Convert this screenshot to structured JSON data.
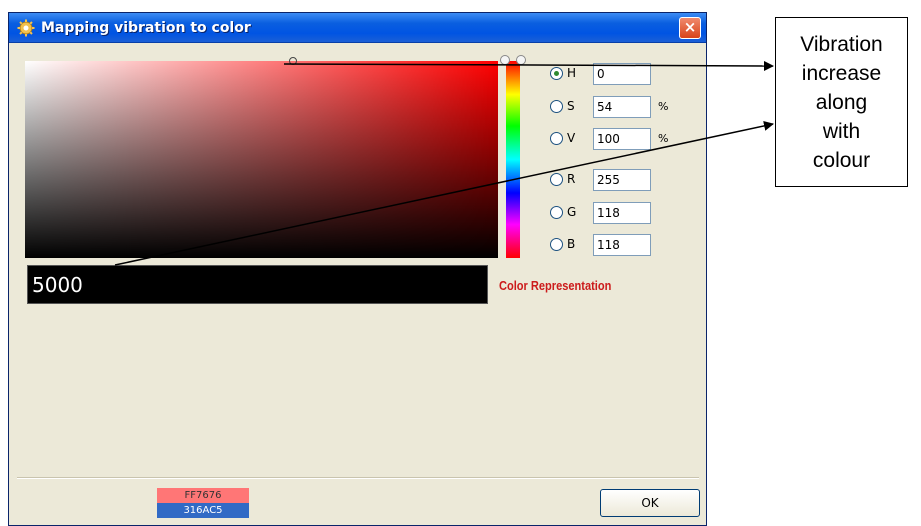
{
  "window": {
    "title": "Mapping vibration to color",
    "close_label": "×"
  },
  "picker": {
    "fields": [
      {
        "letter": "H",
        "value": "0",
        "unit": "",
        "checked": true
      },
      {
        "letter": "S",
        "value": "54",
        "unit": "%",
        "checked": false
      },
      {
        "letter": "V",
        "value": "100",
        "unit": "%",
        "checked": false
      },
      {
        "letter": "R",
        "value": "255",
        "unit": "",
        "checked": false
      },
      {
        "letter": "G",
        "value": "118",
        "unit": "",
        "checked": false
      },
      {
        "letter": "B",
        "value": "118",
        "unit": "",
        "checked": false
      }
    ],
    "hue_color": "#ff0000"
  },
  "value_display": {
    "value": "5000",
    "label": "Color Representation",
    "label_color": "#cc1b1b"
  },
  "swatches": {
    "new_hex": "FF7676",
    "new_color": "#ff7676",
    "old_hex": "316AC5",
    "old_color": "#316ac5"
  },
  "buttons": {
    "ok_label": "OK"
  },
  "annotation": {
    "lines": [
      "Vibration",
      "increase",
      "along",
      "with",
      "colour"
    ]
  }
}
